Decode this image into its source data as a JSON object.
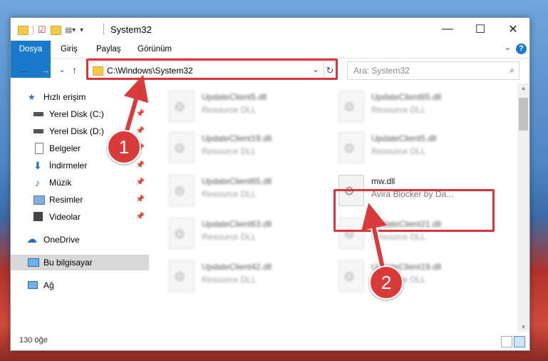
{
  "window": {
    "title": "System32",
    "controls": {
      "minimize": "—",
      "maximize": "☐",
      "close": "✕"
    }
  },
  "ribbon": {
    "tabs": [
      "Dosya",
      "Giriş",
      "Paylaş",
      "Görünüm"
    ],
    "help": "?"
  },
  "address": {
    "path": "C:\\Windows\\System32",
    "search_placeholder": "Ara: System32"
  },
  "sidebar": {
    "items": [
      {
        "label": "Hızlı erişim",
        "icon": "star-icon",
        "pinned": false
      },
      {
        "label": "Yerel Disk (C:)",
        "icon": "drive-icon",
        "pinned": true
      },
      {
        "label": "Yerel Disk (D:)",
        "icon": "drive-icon",
        "pinned": true
      },
      {
        "label": "Belgeler",
        "icon": "documents-icon",
        "pinned": true
      },
      {
        "label": "İndirmeler",
        "icon": "download-icon",
        "pinned": true
      },
      {
        "label": "Müzik",
        "icon": "music-icon",
        "pinned": true
      },
      {
        "label": "Resimler",
        "icon": "pictures-icon",
        "pinned": true
      },
      {
        "label": "Videolar",
        "icon": "video-icon",
        "pinned": true
      },
      {
        "label": "OneDrive",
        "icon": "cloud-icon",
        "pinned": false
      },
      {
        "label": "Bu bilgisayar",
        "icon": "computer-icon",
        "pinned": false,
        "selected": true
      },
      {
        "label": "Ağ",
        "icon": "network-icon",
        "pinned": false
      }
    ]
  },
  "files": [
    {
      "name": "UpdateClient5.dll",
      "desc": "Resource DLL"
    },
    {
      "name": "UpdateClient65.dll",
      "desc": "Resource DLL"
    },
    {
      "name": "UpdateClient19.dll",
      "desc": "Resource DLL"
    },
    {
      "name": "UpdateClient5.dll",
      "desc": "Resource DLL"
    },
    {
      "name": "UpdateClient65.dll",
      "desc": "Resource DLL"
    },
    {
      "name": "mw.dll",
      "desc": "Avira Blocker by Da..."
    },
    {
      "name": "UpdateClient63.dll",
      "desc": "Resource DLL"
    },
    {
      "name": "UpdateClient21.dll",
      "desc": "Resource DLL"
    },
    {
      "name": "UpdateClient42.dll",
      "desc": "Resource DLL"
    },
    {
      "name": "UpdateClient19.dll",
      "desc": "Resource DLL"
    }
  ],
  "status": {
    "count": "130 öğe"
  },
  "callouts": [
    "1",
    "2"
  ],
  "colors": {
    "accent": "#1979ca",
    "highlight": "#d9353a"
  }
}
